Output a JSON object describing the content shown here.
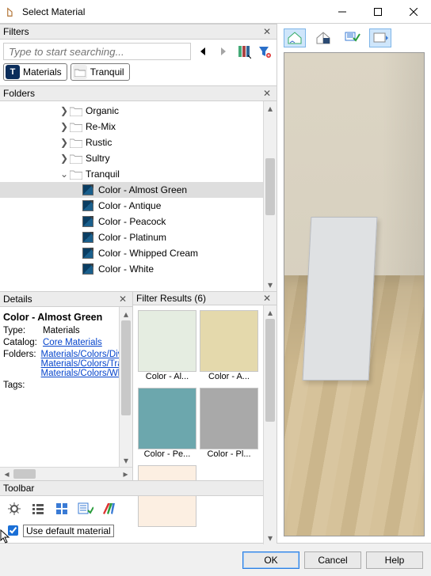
{
  "window": {
    "title": "Select Material"
  },
  "filters": {
    "title": "Filters",
    "search_placeholder": "Type to start searching..."
  },
  "badges": [
    {
      "label": "Materials",
      "icon_letter": "T",
      "icon_style": "navy"
    },
    {
      "label": "Tranquil",
      "icon_letter": "",
      "icon_style": "folder"
    }
  ],
  "folders": {
    "title": "Folders",
    "nodes": [
      {
        "label": "Organic",
        "level": 1,
        "caret": ">"
      },
      {
        "label": "Re-Mix",
        "level": 1,
        "caret": ">"
      },
      {
        "label": "Rustic",
        "level": 1,
        "caret": ">"
      },
      {
        "label": "Sultry",
        "level": 1,
        "caret": ">"
      },
      {
        "label": "Tranquil",
        "level": 1,
        "caret": "v"
      },
      {
        "label": "Color - Almost Green",
        "level": 2,
        "caret": "",
        "selected": true
      },
      {
        "label": "Color - Antique",
        "level": 2,
        "caret": ""
      },
      {
        "label": "Color - Peacock",
        "level": 2,
        "caret": ""
      },
      {
        "label": "Color - Platinum",
        "level": 2,
        "caret": ""
      },
      {
        "label": "Color - Whipped Cream",
        "level": 2,
        "caret": ""
      },
      {
        "label": "Color - White",
        "level": 2,
        "caret": ""
      }
    ]
  },
  "details": {
    "title": "Details",
    "heading": "Color - Almost Green",
    "type_label": "Type:",
    "type_value": "Materials",
    "catalog_label": "Catalog:",
    "catalog_value": "Core Materials",
    "folders_label": "Folders:",
    "folders_links": [
      "Materials/Colors/Divine",
      "Materials/Colors/Tranquil",
      "Materials/Colors/White/Neutral"
    ],
    "tags_label": "Tags:"
  },
  "results": {
    "title": "Filter Results (6)",
    "items": [
      {
        "label": "Color - Al...",
        "color": "#e5ede1"
      },
      {
        "label": "Color - A...",
        "color": "#e4d9ac"
      },
      {
        "label": "Color - Pe...",
        "color": "#6ca7ad"
      },
      {
        "label": "Color - Pl...",
        "color": "#a9a9a9"
      },
      {
        "label": "",
        "color": "#fcefe2"
      },
      {
        "label": "",
        "color": "#ffffff"
      }
    ]
  },
  "toolbar": {
    "title": "Toolbar"
  },
  "checkbox": {
    "label": "Use default material",
    "checked": true
  },
  "buttons": {
    "ok": "OK",
    "cancel": "Cancel",
    "help": "Help"
  }
}
